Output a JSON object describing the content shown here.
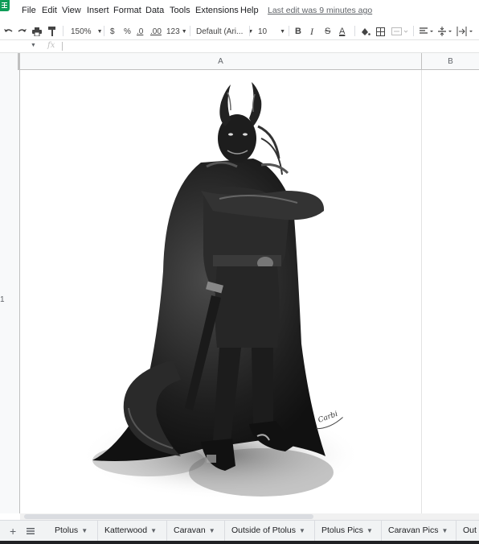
{
  "menu": {
    "items": [
      "File",
      "Edit",
      "View",
      "Insert",
      "Format",
      "Data",
      "Tools",
      "Extensions",
      "Help"
    ],
    "last_edit": "Last edit was 9 minutes ago"
  },
  "toolbar": {
    "zoom": "150%",
    "currency": "$",
    "percent": "%",
    "decrease_decimal": ".0",
    "increase_decimal": ".00",
    "more_formats": "123",
    "font": "Default (Ari...",
    "font_size": "10",
    "bold": "B",
    "italic": "I",
    "strike": "S",
    "text_color": "A"
  },
  "formula_bar": {
    "fx": "fx"
  },
  "columns": [
    "A",
    "B"
  ],
  "rows": [
    "1"
  ],
  "sheets": [
    "Ptolus",
    "Katterwood",
    "Caravan",
    "Outside of Ptolus",
    "Ptolus Pics",
    "Caravan Pics",
    "Out"
  ],
  "colors": {
    "sheets_green": "#0f9d58",
    "header_bg": "#f8f9fa",
    "tabbar_bg": "#f1f3f4"
  },
  "image": {
    "description_icon": "horned-armored-figure-illustration",
    "signature": "Carbi"
  }
}
